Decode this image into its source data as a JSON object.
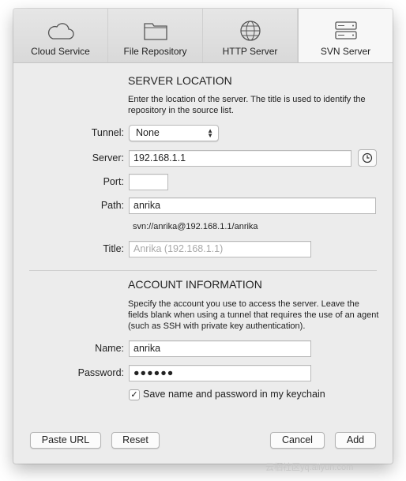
{
  "tabs": [
    {
      "label": "Cloud Service",
      "icon": "cloud-icon"
    },
    {
      "label": "File Repository",
      "icon": "folder-icon"
    },
    {
      "label": "HTTP Server",
      "icon": "globe-icon"
    },
    {
      "label": "SVN Server",
      "icon": "server-icon"
    }
  ],
  "active_tab": "SVN Server",
  "server_location": {
    "title": "SERVER LOCATION",
    "description": "Enter the location of the server. The title is used to identify the repository in the source list.",
    "tunnel_label": "Tunnel:",
    "tunnel_value": "None",
    "server_label": "Server:",
    "server_value": "192.168.1.1",
    "port_label": "Port:",
    "port_value": "",
    "path_label": "Path:",
    "path_value": "anrika",
    "svn_url": "svn://anrika@192.168.1.1/anrika",
    "title_label": "Title:",
    "title_placeholder": "Anrika (192.168.1.1)"
  },
  "account": {
    "title": "ACCOUNT INFORMATION",
    "description": "Specify the account you use to access the server. Leave the fields blank when using a tunnel that requires the use of an agent (such as SSH with private key authentication).",
    "name_label": "Name:",
    "name_value": "anrika",
    "password_label": "Password:",
    "password_value": "●●●●●●",
    "keychain_label": "Save name and password in my keychain",
    "keychain_checked": true
  },
  "buttons": {
    "paste_url": "Paste URL",
    "reset": "Reset",
    "cancel": "Cancel",
    "add": "Add"
  },
  "watermark": "云栖社区yq.aliyun.com"
}
